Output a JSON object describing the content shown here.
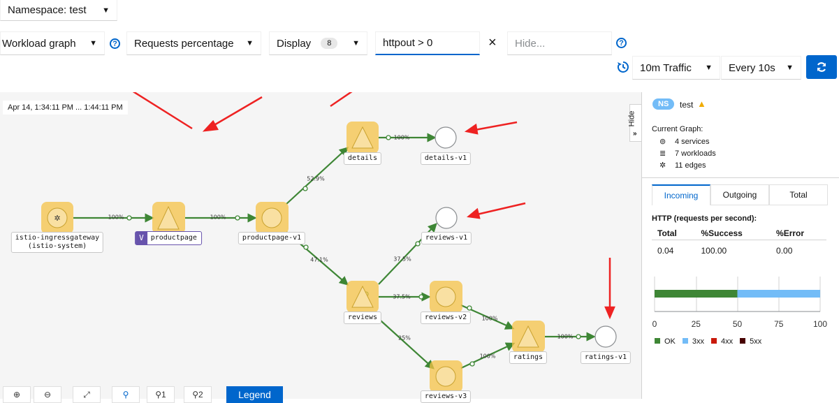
{
  "toolbar": {
    "namespace_label": "Namespace: test",
    "graph_type": "Workload graph",
    "edge_labels": "Requests percentage",
    "display_label": "Display",
    "display_count": "8",
    "find_value": "httpout > 0",
    "hide_placeholder": "Hide...",
    "clear_icon": "×",
    "traffic_duration": "10m Traffic",
    "refresh_interval": "Every 10s"
  },
  "graph": {
    "time_range": "Apr 14, 1:34:11 PM ... 1:44:11 PM",
    "hide_tab": "Hide",
    "nodes": {
      "ingress": "istio-ingressgateway\n(istio-system)",
      "productpage_svc": "productpage",
      "productpage_v1": "productpage-v1",
      "details_svc": "details",
      "details_v1": "details-v1",
      "reviews_svc": "reviews",
      "reviews_v1": "reviews-v1",
      "reviews_v2": "reviews-v2",
      "reviews_v3": "reviews-v3",
      "ratings_svc": "ratings",
      "ratings_v1": "ratings-v1"
    },
    "edges": {
      "e1": "100%",
      "e2": "100%",
      "e3": "52.9%",
      "e4": "100%",
      "e5": "47.1%",
      "e6": "37.5%",
      "e7": "37.5%",
      "e8": "25%",
      "e9": "100%",
      "e10": "100%",
      "e11": "100%"
    }
  },
  "bottom_toolbar": {
    "legend": "Legend",
    "layout1": "1",
    "layout2": "2"
  },
  "sidebar": {
    "ns_badge": "NS",
    "ns_name": "test",
    "current_graph": "Current Graph:",
    "services": "4 services",
    "workloads": "7 workloads",
    "edges": "11 edges",
    "tabs": [
      "Incoming",
      "Outgoing",
      "Total"
    ],
    "http_title": "HTTP (requests per second):",
    "columns": [
      "Total",
      "%Success",
      "%Error"
    ],
    "values": [
      "0.04",
      "100.00",
      "0.00"
    ],
    "chart": {
      "ticks": [
        "0",
        "25",
        "50",
        "75",
        "100"
      ],
      "legend": [
        "OK",
        "3xx",
        "4xx",
        "5xx"
      ]
    }
  },
  "chart_data": {
    "type": "bar",
    "categories": [
      "HTTP"
    ],
    "series": [
      {
        "name": "OK",
        "values": [
          50
        ]
      },
      {
        "name": "3xx",
        "values": [
          50
        ]
      }
    ],
    "xlim": [
      0,
      100
    ]
  },
  "colors": {
    "accent": "#0066cc",
    "edge": "#3e8635",
    "node": "#f4c145",
    "node_fill": "#f9e0a2",
    "ok": "#3e8635",
    "3xx": "#73bcf7",
    "4xx": "#c9190b",
    "5xx": "#470000",
    "arrow": "#ee2222"
  }
}
